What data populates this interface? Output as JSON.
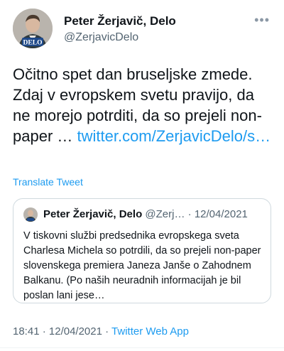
{
  "author": {
    "name": "Peter Žerjavič, Delo",
    "handle": "@ZerjavicDelo",
    "badge": "DELO",
    "avatar_icon": "person-avatar"
  },
  "more_icon": "ellipsis",
  "tweet": {
    "text": "Očitno spet dan bruseljske zmede. Zdaj v evropskem svetu pravijo, da ne morejo potrditi, da so prejeli non-paper … ",
    "link": "twitter.com/ZerjavicDelo/s…"
  },
  "translate_label": "Translate Tweet",
  "quoted": {
    "name": "Peter Žerjavič, Delo",
    "handle": "@Zerj…",
    "separator": "·",
    "date": "12/04/2021",
    "text": "V tiskovni službi predsednika evropskega sveta Charlesa Michela so potrdili, da so prejeli non-paper slovenskega premiera Janeza Janše o Zahodnem Balkanu. (Po naših neuradnih informacijah je bil poslan lani jese…"
  },
  "meta": {
    "time": "18:41",
    "separator": "·",
    "date": "12/04/2021",
    "app": "Twitter Web App"
  },
  "colors": {
    "accent": "#1d9bf0",
    "muted": "#536471",
    "delo_badge": "#1f4a8a"
  }
}
